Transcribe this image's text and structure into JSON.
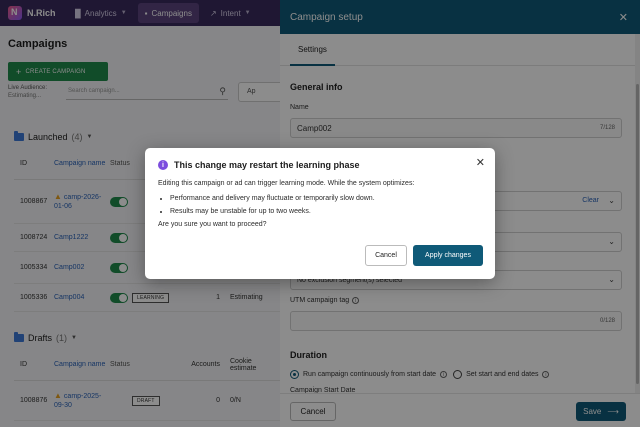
{
  "nav": {
    "brand": "N.Rich",
    "items": [
      {
        "label": "Analytics",
        "active": false
      },
      {
        "label": "Campaigns",
        "active": true
      },
      {
        "label": "Intent",
        "active": false
      }
    ]
  },
  "page": {
    "title": "Campaigns",
    "create_label": "CREATE CAMPAIGN",
    "live_audience_label": "Live Audience:",
    "live_audience_value": "Estimating...",
    "search_placeholder": "Search campaign...",
    "filter_label": "Ap"
  },
  "launched": {
    "title": "Launched",
    "count": "(4)",
    "columns": [
      "ID",
      "Campaign name",
      "Status"
    ],
    "rows": [
      {
        "id": "1008867",
        "name": "camp-2026-01-06",
        "warn": true,
        "toggle": "on",
        "accounts": "",
        "estimate": ""
      },
      {
        "id": "1008724",
        "name": "Camp1222",
        "warn": false,
        "toggle": "on",
        "accounts": "",
        "estimate": ""
      },
      {
        "id": "1005334",
        "name": "Camp002",
        "warn": false,
        "toggle": "on",
        "accounts": "",
        "estimate": ""
      },
      {
        "id": "1005336",
        "name": "Camp004",
        "warn": false,
        "toggle": "on",
        "status_badge": "LEARNING",
        "accounts": "1",
        "estimate": "Estimating"
      }
    ]
  },
  "drafts": {
    "title": "Drafts",
    "count": "(1)",
    "columns": [
      "ID",
      "Campaign name",
      "Status",
      "Accounts",
      "Cookie estimate"
    ],
    "rows": [
      {
        "id": "1008876",
        "name": "camp-2025-09-30",
        "warn": true,
        "status_badge": "DRAFT",
        "accounts": "0",
        "estimate": "0/N"
      }
    ]
  },
  "panel": {
    "title": "Campaign setup",
    "tab": "Settings",
    "general_info": "General info",
    "name_label": "Name",
    "name_value": "Camp002",
    "name_counter": "7/128",
    "clear_label": "Clear",
    "exclusion_value": "No exclusion segment(s) selected",
    "utm_label": "UTM campaign tag",
    "utm_counter": "0/128",
    "duration_title": "Duration",
    "radio_continuous": "Run campaign continuously from start date",
    "radio_dates": "Set start and end dates",
    "start_date_label": "Campaign Start Date",
    "cancel_label": "Cancel",
    "save_label": "Save"
  },
  "modal": {
    "title": "This change may restart the learning phase",
    "intro": "Editing this campaign or ad can trigger learning mode. While the system optimizes:",
    "bullets": [
      "Performance and delivery may fluctuate or temporarily slow down.",
      "Results may be unstable for up to two weeks."
    ],
    "question": "Are you sure you want to proceed?",
    "cancel_label": "Cancel",
    "apply_label": "Apply changes"
  },
  "colors": {
    "nav_bg": "#3a2a5e",
    "primary": "#0f5a78",
    "create_green": "#1f8a4c",
    "info_purple": "#7c4dde",
    "warning": "#e7a020",
    "link": "#2a62b8"
  }
}
